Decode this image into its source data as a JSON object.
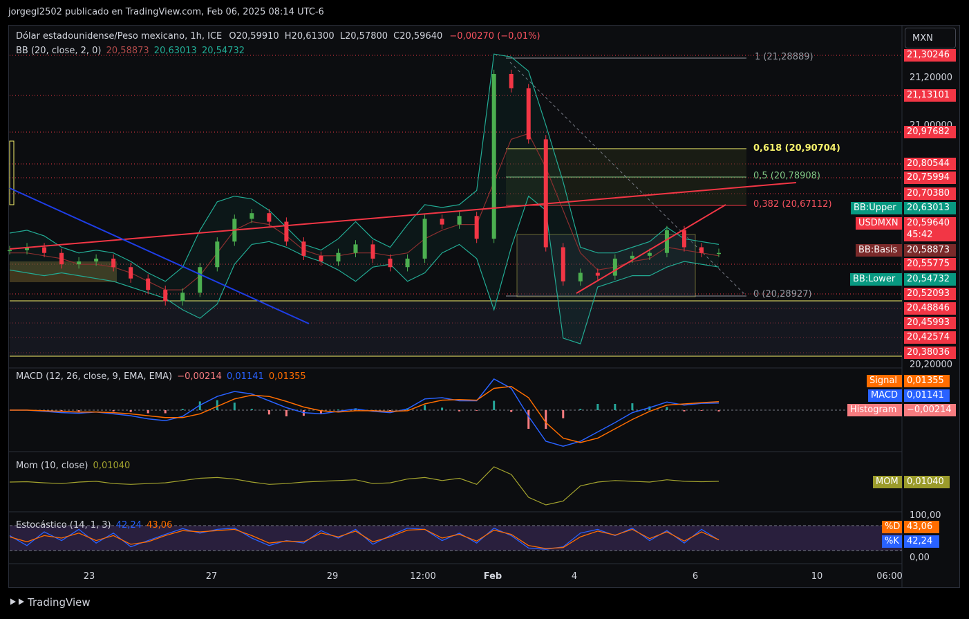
{
  "header": {
    "publisher": "jorgegl2502 publicado en TradingView.com, Feb 06, 2025 08:14 UTC-6"
  },
  "currency_button": "MXN",
  "main_legend": {
    "symbol": "Dólar estadounidense/Peso mexicano, 1h, ICE",
    "open": "O20,59910",
    "high": "H20,61300",
    "low": "L20,57800",
    "close": "C20,59640",
    "change": "−0,00270 (−0,01%)"
  },
  "bb_legend": {
    "name": "BB (20, close, 2, 0)",
    "basis": "20,58873",
    "upper": "20,63013",
    "lower": "20,54732"
  },
  "fib_labels": {
    "l1": "1 (21,28889)",
    "l618": "0,618 (20,90704)",
    "l5": "0,5 (20,78908)",
    "l382": "0,382 (20,67112)",
    "l0": "0 (20,28927)"
  },
  "price_axis": {
    "plain_ticks": [
      "21,20000",
      "21,00000",
      "20,20000"
    ],
    "red_levels": [
      "21,30246",
      "21,13101",
      "20,97682",
      "20,80544",
      "20,75994",
      "20,70380",
      "20,55775",
      "20,52093",
      "20,48846",
      "20,45993",
      "20,42574",
      "20,38036"
    ],
    "bb_upper_label": "BB:Upper",
    "bb_upper_value": "20,63013",
    "symbol_label": "USDMXN",
    "symbol_value": "20,59640",
    "countdown": "45:42",
    "bb_basis_label": "BB:Basis",
    "bb_basis_value": "20,58873",
    "bb_lower_label": "BB:Lower",
    "bb_lower_value": "20,54732",
    "colors": {
      "red": "#f23645",
      "teal": "#089981",
      "basis": "#7b2a2a",
      "yellow": "#f7f26b"
    }
  },
  "macd": {
    "legend_name": "MACD (12, 26, close, 9, EMA, EMA)",
    "hist": "−0,00214",
    "macd": "0,01141",
    "signal": "0,01355",
    "signal_label": "Signal",
    "macd_label": "MACD",
    "hist_label": "Histogram",
    "colors": {
      "macd": "#2962ff",
      "signal": "#ff6d00",
      "hist": "#f77c80"
    }
  },
  "mom": {
    "legend_name": "Mom (10, close)",
    "value": "0,01040",
    "label": "MOM",
    "color": "#9b9b2b"
  },
  "stoch": {
    "legend_name": "Estocástico (14, 1, 3)",
    "k": "42,24",
    "d": "43,06",
    "d_label": "%D",
    "k_label": "%K",
    "top_tick": "100,00",
    "bottom_tick": "0,00",
    "colors": {
      "k": "#2962ff",
      "d": "#ff6d00"
    }
  },
  "time_axis": [
    "23",
    "27",
    "29",
    "12:00",
    "Feb",
    "4",
    "6",
    "10",
    "06:00"
  ],
  "footer": "TradingView",
  "chart_data": {
    "type": "line",
    "title": "Dólar estadounidense/Peso mexicano, 1h, ICE",
    "x_ticks": [
      "23",
      "27",
      "29",
      "12:00",
      "Feb",
      "4",
      "6",
      "10",
      "06:00"
    ],
    "ylim": [
      20.2,
      21.32
    ],
    "series": [
      {
        "name": "USDMXN",
        "values": [
          20.61,
          20.62,
          20.6,
          20.56,
          20.57,
          20.58,
          20.55,
          20.51,
          20.47,
          20.43,
          20.46,
          20.55,
          20.64,
          20.72,
          20.74,
          20.71,
          20.64,
          20.59,
          20.57,
          20.6,
          20.63,
          20.58,
          20.55,
          20.58,
          20.72,
          20.7,
          20.73,
          20.65,
          21.23,
          21.18,
          21.0,
          20.62,
          20.5,
          20.53,
          20.52,
          20.58,
          20.59,
          20.6,
          20.68,
          20.62,
          20.6,
          20.6
        ]
      },
      {
        "name": "BB:Upper",
        "values": [
          20.67,
          20.68,
          20.66,
          20.62,
          20.6,
          20.61,
          20.6,
          20.57,
          20.53,
          20.5,
          20.55,
          20.68,
          20.78,
          20.8,
          20.79,
          20.75,
          20.69,
          20.63,
          20.61,
          20.65,
          20.71,
          20.65,
          20.62,
          20.7,
          20.77,
          20.76,
          20.77,
          20.82,
          21.3,
          21.29,
          21.24,
          21.05,
          20.85,
          20.62,
          20.6,
          20.6,
          20.62,
          20.64,
          20.69,
          20.65,
          20.64,
          20.63
        ]
      },
      {
        "name": "BB:Basis",
        "values": [
          20.6,
          20.6,
          20.59,
          20.58,
          20.56,
          20.56,
          20.55,
          20.53,
          20.5,
          20.47,
          20.47,
          20.52,
          20.6,
          20.68,
          20.71,
          20.7,
          20.66,
          20.61,
          20.59,
          20.59,
          20.6,
          20.6,
          20.59,
          20.6,
          20.65,
          20.68,
          20.7,
          20.7,
          20.85,
          21.0,
          21.02,
          20.9,
          20.75,
          20.6,
          20.54,
          20.55,
          20.57,
          20.58,
          20.62,
          20.61,
          20.6,
          20.59
        ]
      },
      {
        "name": "BB:Lower",
        "values": [
          20.54,
          20.53,
          20.52,
          20.53,
          20.52,
          20.51,
          20.5,
          20.48,
          20.46,
          20.44,
          20.4,
          20.37,
          20.42,
          20.56,
          20.63,
          20.64,
          20.62,
          20.59,
          20.57,
          20.54,
          20.5,
          20.55,
          20.56,
          20.5,
          20.53,
          20.6,
          20.63,
          20.58,
          20.4,
          20.62,
          20.8,
          20.75,
          20.3,
          20.28,
          20.48,
          20.5,
          20.52,
          20.52,
          20.55,
          20.57,
          20.56,
          20.55
        ]
      }
    ],
    "fibonacci": [
      {
        "level": "1",
        "value": 21.28889
      },
      {
        "level": "0,618",
        "value": 20.90704
      },
      {
        "level": "0,5",
        "value": 20.78908
      },
      {
        "level": "0,382",
        "value": 20.67112
      },
      {
        "level": "0",
        "value": 20.28927
      }
    ],
    "macd": {
      "macd": [
        0.0,
        0.0,
        -0.002,
        -0.004,
        -0.005,
        -0.003,
        -0.006,
        -0.009,
        -0.014,
        -0.017,
        -0.01,
        0.008,
        0.022,
        0.03,
        0.026,
        0.015,
        0.004,
        -0.004,
        -0.006,
        -0.002,
        0.002,
        -0.002,
        -0.004,
        0.002,
        0.018,
        0.02,
        0.015,
        0.015,
        0.05,
        0.035,
        -0.01,
        -0.05,
        -0.058,
        -0.05,
        -0.035,
        -0.02,
        -0.004,
        0.004,
        0.013,
        0.008,
        0.011,
        0.0114
      ],
      "signal": [
        0.0,
        0.0,
        -0.001,
        -0.002,
        -0.003,
        -0.003,
        -0.004,
        -0.006,
        -0.009,
        -0.012,
        -0.012,
        -0.006,
        0.006,
        0.018,
        0.024,
        0.022,
        0.014,
        0.005,
        -0.001,
        -0.003,
        -0.001,
        -0.001,
        -0.002,
        -0.001,
        0.01,
        0.016,
        0.017,
        0.016,
        0.035,
        0.038,
        0.02,
        -0.02,
        -0.045,
        -0.052,
        -0.045,
        -0.03,
        -0.015,
        -0.002,
        0.008,
        0.01,
        0.012,
        0.01355
      ]
    },
    "momentum": [
      0.0,
      0.005,
      -0.01,
      -0.02,
      0.0,
      0.01,
      -0.02,
      -0.03,
      -0.02,
      -0.01,
      0.02,
      0.05,
      0.06,
      0.04,
      0.0,
      -0.03,
      -0.02,
      0.0,
      0.01,
      0.02,
      0.03,
      -0.02,
      -0.01,
      0.04,
      0.06,
      0.02,
      0.05,
      -0.03,
      0.2,
      0.1,
      -0.2,
      -0.3,
      -0.25,
      -0.05,
      0.0,
      0.02,
      0.01,
      0.0,
      0.03,
      0.01,
      0.005,
      0.0104
    ],
    "stochastic": {
      "k": [
        60,
        20,
        75,
        40,
        85,
        30,
        70,
        15,
        40,
        65,
        88,
        70,
        85,
        90,
        50,
        20,
        40,
        30,
        80,
        50,
        85,
        25,
        60,
        90,
        85,
        40,
        70,
        30,
        90,
        60,
        10,
        5,
        15,
        70,
        85,
        60,
        90,
        40,
        80,
        30,
        85,
        42.24
      ],
      "d": [
        55,
        35,
        60,
        50,
        70,
        40,
        60,
        25,
        35,
        60,
        80,
        75,
        80,
        85,
        60,
        30,
        38,
        35,
        70,
        55,
        78,
        35,
        55,
        82,
        85,
        50,
        65,
        38,
        82,
        65,
        20,
        8,
        12,
        55,
        78,
        62,
        85,
        48,
        75,
        38,
        75,
        43.06
      ]
    }
  }
}
